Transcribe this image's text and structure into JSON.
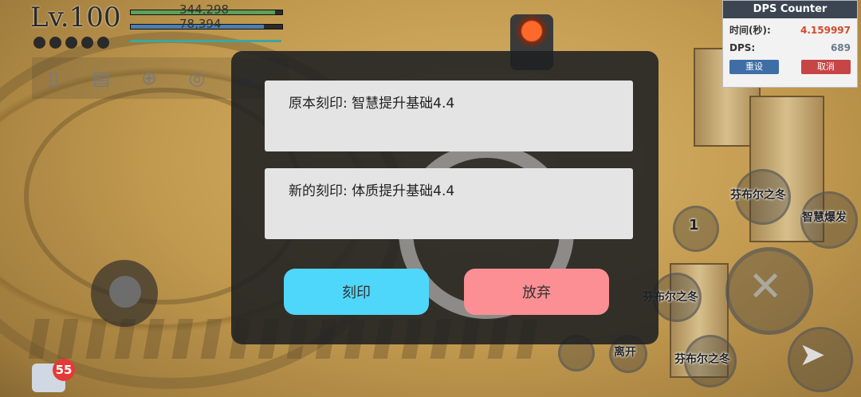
{
  "hud": {
    "level": "Lv.100",
    "hp": "344,298",
    "mp": "78,394",
    "icons": [
      "phone-icon",
      "scroll-icon",
      "globe-icon",
      "headset-icon",
      "cloud-icon"
    ]
  },
  "dps_panel": {
    "title": "DPS Counter",
    "time_label": "时间(秒):",
    "time_value": "4.159997",
    "dps_label": "DPS:",
    "dps_value": "689",
    "reset_label": "重设",
    "cancel_label": "取消"
  },
  "skills": {
    "skill_1": "芬布尔之冬",
    "skill_2": "智慧爆发",
    "skill_3": "芬布尔之冬",
    "skill_4": "芬布尔之冬",
    "slot_number": "1",
    "leave": "离开"
  },
  "chat": {
    "badge_count": "55"
  },
  "dialog": {
    "original_engraving": "原本刻印: 智慧提升基础4.4",
    "new_engraving": "新的刻印: 体质提升基础4.4",
    "engrave_button": "刻印",
    "abandon_button": "放弃"
  },
  "colors": {
    "engrave_button": "#4fd7fb",
    "abandon_button": "#fb8f93",
    "overlay": "#1e2022"
  }
}
